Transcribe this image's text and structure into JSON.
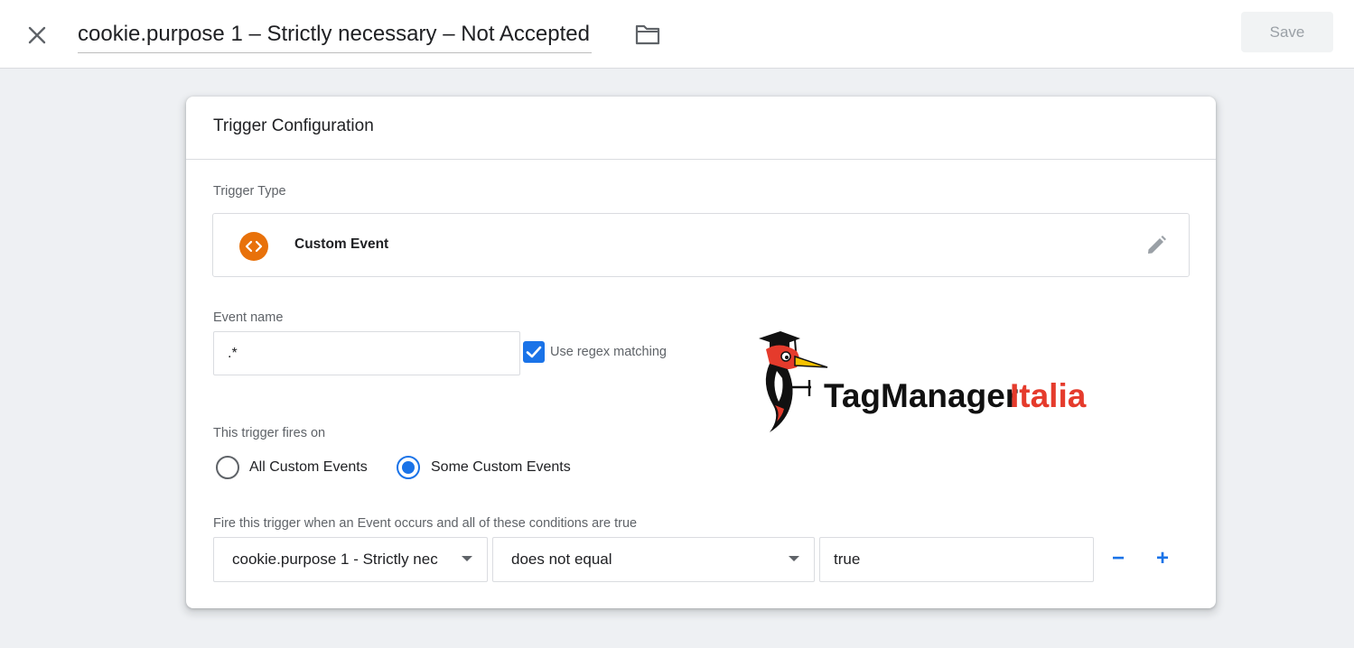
{
  "header": {
    "title": "cookie.purpose 1 – Strictly necessary – Not Accepted",
    "save_label": "Save"
  },
  "card": {
    "title": "Trigger Configuration",
    "trigger_type_label": "Trigger Type",
    "trigger_type_name": "Custom Event",
    "event_name_label": "Event name",
    "event_name_value": ".*",
    "regex_label": "Use regex matching",
    "regex_checked": true,
    "fires_on_label": "This trigger fires on",
    "radio_options": [
      {
        "label": "All Custom Events",
        "checked": false
      },
      {
        "label": "Some Custom Events",
        "checked": true
      }
    ],
    "condition_label": "Fire this trigger when an Event occurs and all of these conditions are true",
    "condition": {
      "variable": "cookie.purpose 1 - Strictly nec",
      "operator": "does not equal",
      "value": "true",
      "remove_label": "−",
      "add_label": "+"
    }
  },
  "logo": {
    "text_dark": "TagManager",
    "text_red": "Italia"
  },
  "colors": {
    "accent": "#1a73e8",
    "trigger_icon": "#e8710a",
    "logo_red": "#e53b2c"
  }
}
